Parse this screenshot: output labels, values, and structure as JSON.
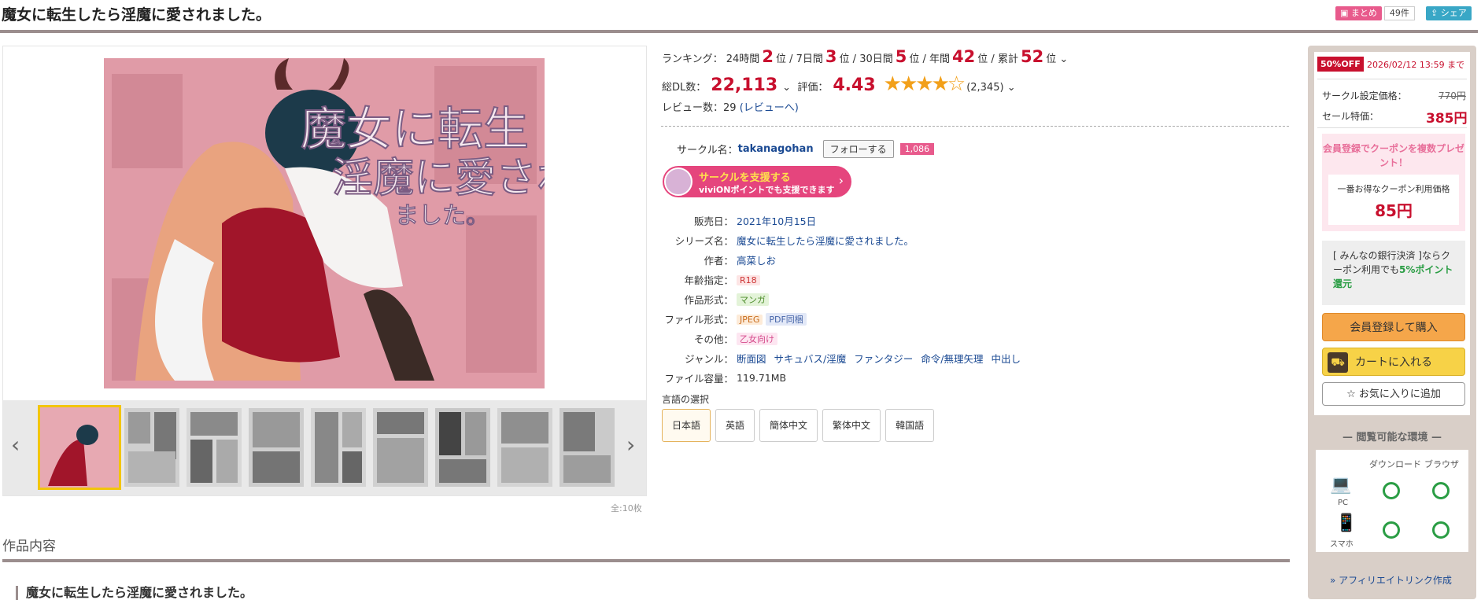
{
  "header": {
    "title": "魔女に転生したら淫魔に愛されました。",
    "matome_label": "まとめ",
    "matome_count": "49件",
    "share_label": "シェア"
  },
  "gallery": {
    "count_label": "全:10枚",
    "prev": "‹",
    "next": "›"
  },
  "ranking": {
    "label": "ランキング：",
    "items": [
      {
        "period": "24時間",
        "rank": "2",
        "suffix": "位"
      },
      {
        "period": "7日間",
        "rank": "3",
        "suffix": "位"
      },
      {
        "period": "30日間",
        "rank": "5",
        "suffix": "位"
      },
      {
        "period": "年間",
        "rank": "42",
        "suffix": "位"
      },
      {
        "period": "累計",
        "rank": "52",
        "suffix": "位"
      }
    ]
  },
  "downloads": {
    "label": "総DL数：",
    "value": "22,113",
    "rating_label": "評価：",
    "rating": "4.43",
    "rating_fraction": 0.886,
    "rating_count": "(2,345)"
  },
  "reviews": {
    "label": "レビュー数：",
    "count": "29",
    "link": "(レビューへ)"
  },
  "circle": {
    "label": "サークル名：",
    "name": "takanagohan",
    "follow": "フォローする",
    "followers": "1,086"
  },
  "support": {
    "line1": "サークルを支援する",
    "line2": "viviONポイントでも支援できます"
  },
  "spec": {
    "release_label": "販売日：",
    "release": "2021年10月15日",
    "series_label": "シリーズ名：",
    "series": "魔女に転生したら淫魔に愛されました。",
    "author_label": "作者：",
    "author": "高菜しお",
    "age_label": "年齢指定：",
    "age": "R18",
    "format_label": "作品形式：",
    "format": "マンガ",
    "file_label": "ファイル形式：",
    "file1": "JPEG",
    "file2": "PDF同梱",
    "other_label": "その他：",
    "other": "乙女向け",
    "genre_label": "ジャンル：",
    "genres": [
      "断面図",
      "サキュバス/淫魔",
      "ファンタジー",
      "命令/無理矢理",
      "中出し"
    ],
    "size_label": "ファイル容量：",
    "size": "119.71MB"
  },
  "language": {
    "label": "言語の選択",
    "options": [
      "日本語",
      "英語",
      "簡体中文",
      "繁体中文",
      "韓国語"
    ]
  },
  "content": {
    "section": "作品内容",
    "subtitle": "魔女に転生したら淫魔に愛されました。"
  },
  "sidebar": {
    "off": "50%OFF",
    "deadline": "2026/02/12 13:59 まで",
    "list_label": "サークル設定価格：",
    "list_price": "770円",
    "sale_label": "セール特価：",
    "sale_price": "385円",
    "coupon_head": "会員登録でクーポンを複数プレゼント！",
    "coupon_label": "一番お得なクーポン利用価格",
    "coupon_price": "85円",
    "bank_text": "[ みんなの銀行決済 ]ならクーポン利用でも",
    "bank_bonus": "5%ポイント還元",
    "register_buy": "会員登録して購入",
    "cart": "カートに入れる",
    "favorite": "お気に入りに追加",
    "env_title": "閲覧可能な環境",
    "env_cols": [
      "ダウンロード",
      "ブラウザ"
    ],
    "env_pc": "PC",
    "env_sp": "スマホ",
    "affiliate": "» アフィリエイトリンク作成"
  },
  "colors": {
    "accent_red": "#c8102e",
    "pink": "#e85a8c",
    "border_brown": "#9b8e8e",
    "ok_green": "#2a9d44"
  }
}
